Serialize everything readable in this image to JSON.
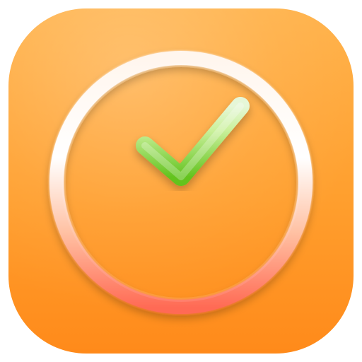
{
  "icon": {
    "name": "app-icon",
    "glyph": "clock-check-icon",
    "colors": {
      "background_top": "#FFB24A",
      "background_bottom": "#FF8A1A",
      "ring_light": "#FFF6EE",
      "ring_warm": "#FF6B55",
      "check_light": "#E6F7D8",
      "check_green": "#63C31E"
    }
  }
}
